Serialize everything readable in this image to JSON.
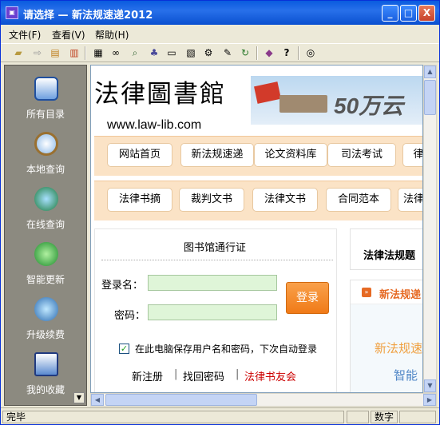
{
  "window": {
    "title": "请选择 — 新法规速递2012",
    "minimize": "_",
    "maximize": "□",
    "close": "X"
  },
  "menu": [
    "文件(F)",
    "查看(V)",
    "帮助(H)"
  ],
  "toolbar_icons": [
    "open-folder-icon",
    "export-icon",
    "import-icon",
    "add-file-icon",
    "book-icon",
    "binoculars-icon",
    "search-doc-icon",
    "tree-icon",
    "card-icon",
    "database-icon",
    "gear-icon",
    "pen-icon",
    "refresh-icon",
    "library-icon",
    "help-icon",
    "info-icon"
  ],
  "sidebar": {
    "items": [
      {
        "label": "所有目录",
        "icon": "window-icon"
      },
      {
        "label": "本地查询",
        "icon": "magnifier-icon"
      },
      {
        "label": "在线查询",
        "icon": "globe-mouse-icon"
      },
      {
        "label": "智能更新",
        "icon": "download-icon"
      },
      {
        "label": "升级续费",
        "icon": "upgrade-globe-icon"
      },
      {
        "label": "我的收藏",
        "icon": "favorites-icon"
      }
    ],
    "scroll_down": "▼"
  },
  "page": {
    "logo": "法律圖書館",
    "url": "www.law-lib.com",
    "banner_text": "50万云",
    "nav_row1": [
      "网站首页",
      "新法规速递",
      "论文资料库",
      "司法考试",
      "律"
    ],
    "nav_row2": [
      "法律书摘",
      "裁判文书",
      "法律文书",
      "合同范本",
      "法律"
    ],
    "login": {
      "title": "图书馆通行证",
      "username_label": "登录名：",
      "password_label": "密码：",
      "username_value": "",
      "password_value": "",
      "submit": "登录",
      "remember_label": "在此电脑保存用户名和密码，下次自动登录",
      "remember_checked": "✓",
      "links": [
        "新注册",
        "找回密码",
        "法律书友会"
      ],
      "separator": "|"
    },
    "right_panel": {
      "title": "法律法规题",
      "section_title": "新法规递",
      "section_mark": "»",
      "promo1": "新法规速",
      "promo2": "智能"
    }
  },
  "status": {
    "left": "完毕",
    "right": "数字"
  },
  "colors": {
    "titlebar": "#0a5bde",
    "sidebar": "#8c8a80",
    "nav_row_bg": "#fbe3c6",
    "input_bg": "#dff5d8",
    "login_button": "#f07a17",
    "red_link": "#cc0000"
  }
}
